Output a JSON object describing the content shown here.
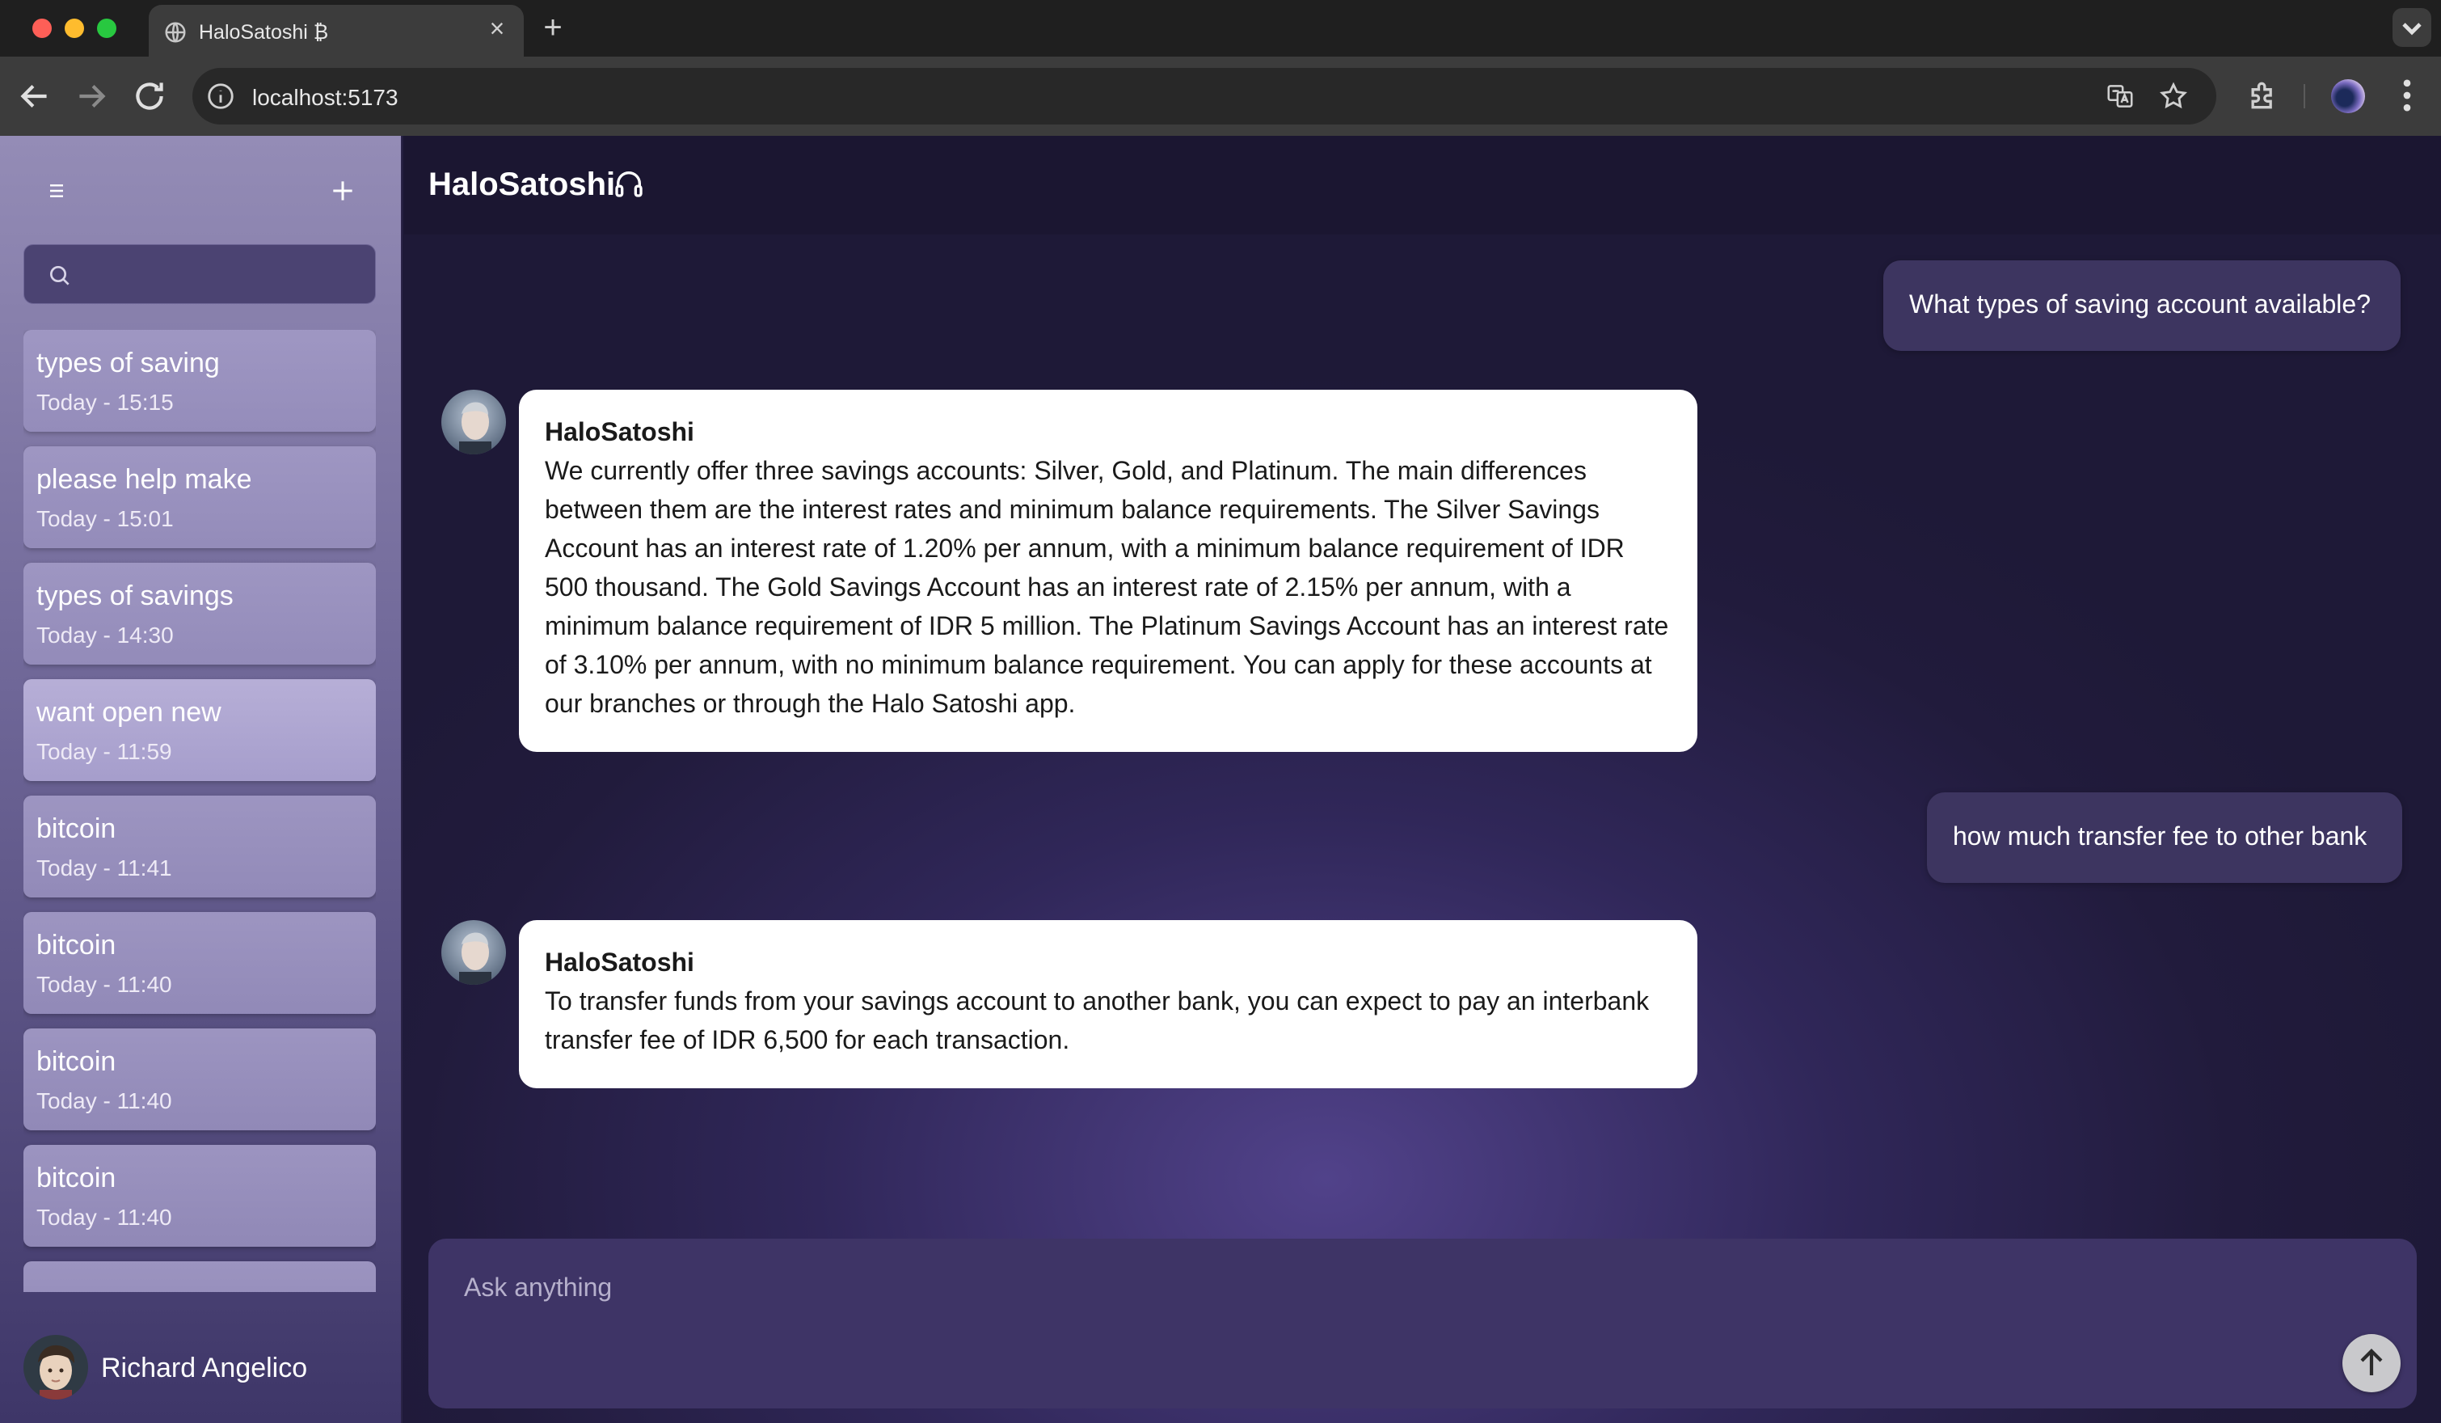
{
  "browser": {
    "tab_title": "HaloSatoshi ₿",
    "url": "localhost:5173",
    "icons": [
      "globe-icon",
      "close-icon",
      "plus-icon",
      "chevron-down-icon",
      "back-arrow-icon",
      "forward-arrow-icon",
      "reload-icon",
      "info-icon",
      "translate-icon",
      "star-icon",
      "puzzle-icon",
      "kebab-menu-icon"
    ]
  },
  "sidebar": {
    "search": {
      "placeholder": ""
    },
    "history": [
      {
        "title": "types of saving",
        "time": "Today - 15:15"
      },
      {
        "title": "please help make",
        "time": "Today - 15:01"
      },
      {
        "title": "types of savings",
        "time": "Today - 14:30"
      },
      {
        "title": "want open new",
        "time": "Today - 11:59"
      },
      {
        "title": "bitcoin",
        "time": "Today - 11:41"
      },
      {
        "title": "bitcoin",
        "time": "Today - 11:40"
      },
      {
        "title": "bitcoin",
        "time": "Today - 11:40"
      },
      {
        "title": "bitcoin",
        "time": "Today - 11:40"
      }
    ],
    "user": {
      "name": "Richard Angelico"
    }
  },
  "header": {
    "title": "HaloSatoshi"
  },
  "messages": [
    {
      "role": "user",
      "text": "What types of saving account available?"
    },
    {
      "role": "bot",
      "name": "HaloSatoshi",
      "text": "We currently offer three savings accounts: Silver, Gold, and Platinum. The main differences between them are the interest rates and minimum balance requirements. The Silver Savings Account has an interest rate of 1.20% per annum, with a minimum balance requirement of IDR 500 thousand. The Gold Savings Account has an interest rate of 2.15% per annum, with a minimum balance requirement of IDR 5 million. The Platinum Savings Account has an interest rate of 3.10% per annum, with no minimum balance requirement. You can apply for these accounts at our branches or through the Halo Satoshi app."
    },
    {
      "role": "user",
      "text": "how much transfer fee to other bank"
    },
    {
      "role": "bot",
      "name": "HaloSatoshi",
      "text": "To transfer funds from your savings account to another bank, you can expect to pay an interbank transfer fee of IDR 6,500 for each transaction."
    }
  ],
  "composer": {
    "placeholder": "Ask anything"
  },
  "colors": {
    "accent": "#3e3466",
    "sidebar": "#6d6596",
    "user_bubble": "#3d3560",
    "bot_bubble": "#ffffff"
  }
}
